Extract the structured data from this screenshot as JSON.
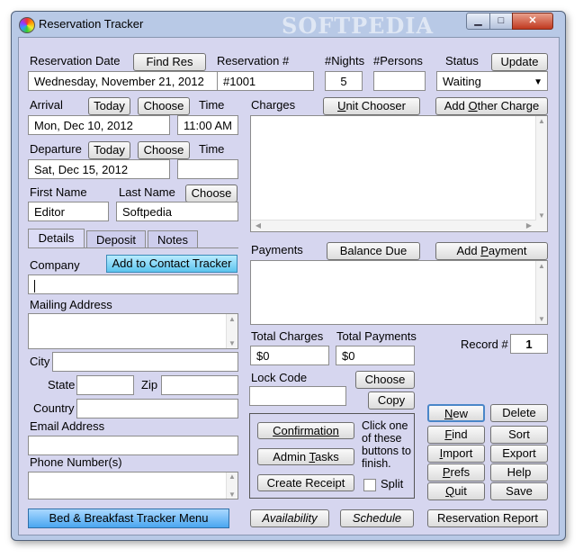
{
  "window": {
    "title": "Reservation Tracker",
    "watermark": "SOFTPEDIA",
    "min_glyph": "▁",
    "max_glyph": "□",
    "close_glyph": "✕"
  },
  "reservation": {
    "date_label": "Reservation Date",
    "find_res_btn": "Find Res",
    "date_value": "Wednesday, November 21, 2012",
    "number_label": "Reservation #",
    "number_value": "#1001",
    "nights_label": "#Nights",
    "nights_value": "5",
    "persons_label": "#Persons",
    "persons_value": "",
    "status_label": "Status",
    "update_btn": "Update",
    "status_value": "Waiting"
  },
  "arrival": {
    "label": "Arrival",
    "today_btn": "Today",
    "choose_btn": "Choose",
    "time_label": "Time",
    "date_value": "Mon, Dec 10, 2012",
    "time_value": "11:00 AM"
  },
  "departure": {
    "label": "Departure",
    "today_btn": "Today",
    "choose_btn": "Choose",
    "time_label": "Time",
    "date_value": "Sat, Dec 15, 2012",
    "time_value": ""
  },
  "guest": {
    "first_label": "First Name",
    "last_label": "Last Name",
    "choose_btn": "Choose",
    "first_value": "Editor",
    "last_value": "Softpedia"
  },
  "tabs": [
    "Details",
    "Deposit",
    "Notes"
  ],
  "details": {
    "company_label": "Company",
    "contact_btn": "Add to Contact Tracker",
    "company_value": "",
    "mailing_label": "Mailing Address",
    "city_label": "City",
    "state_label": "State",
    "zip_label": "Zip",
    "country_label": "Country",
    "email_label": "Email Address",
    "phone_label": "Phone Number(s)"
  },
  "charges": {
    "label": "Charges",
    "unit_btn_pre": "",
    "unit_btn_ul": "U",
    "unit_btn_post": "nit Chooser",
    "other_btn_pre": "Add ",
    "other_btn_ul": "O",
    "other_btn_post": "ther Charge"
  },
  "payments": {
    "label": "Payments",
    "balance_btn": "Balance Due",
    "add_btn_pre": "Add ",
    "add_btn_ul": "P",
    "add_btn_post": "ayment"
  },
  "totals": {
    "charges_label": "Total Charges",
    "charges_value": "$0",
    "payments_label": "Total Payments",
    "payments_value": "$0"
  },
  "record": {
    "label": "Record #",
    "value": "1"
  },
  "lock": {
    "label": "Lock Code",
    "choose_btn": "Choose",
    "copy_btn": "Copy",
    "value": ""
  },
  "actions": {
    "confirmation_btn": "Confirmation",
    "admin_btn_pre": "Admin ",
    "admin_btn_ul": "T",
    "admin_btn_post": "asks",
    "receipt_btn": "Create Receipt",
    "hint": "Click one of these buttons to finish.",
    "split_label": "Split"
  },
  "record_btns": {
    "new_ul": "N",
    "new_post": "ew",
    "delete": "Delete",
    "find_ul": "F",
    "find_post": "ind",
    "sort": "Sort",
    "import_ul": "I",
    "import_post": "mport",
    "export": "Export",
    "prefs_ul": "P",
    "prefs_post": "refs",
    "help": "Help",
    "quit_ul": "Q",
    "quit_post": "uit",
    "save": "Save"
  },
  "bottom": {
    "menu_btn": "Bed & Breakfast Tracker Menu",
    "availability_btn": "Availability",
    "schedule_btn": "Schedule",
    "report_btn": "Reservation Report"
  }
}
